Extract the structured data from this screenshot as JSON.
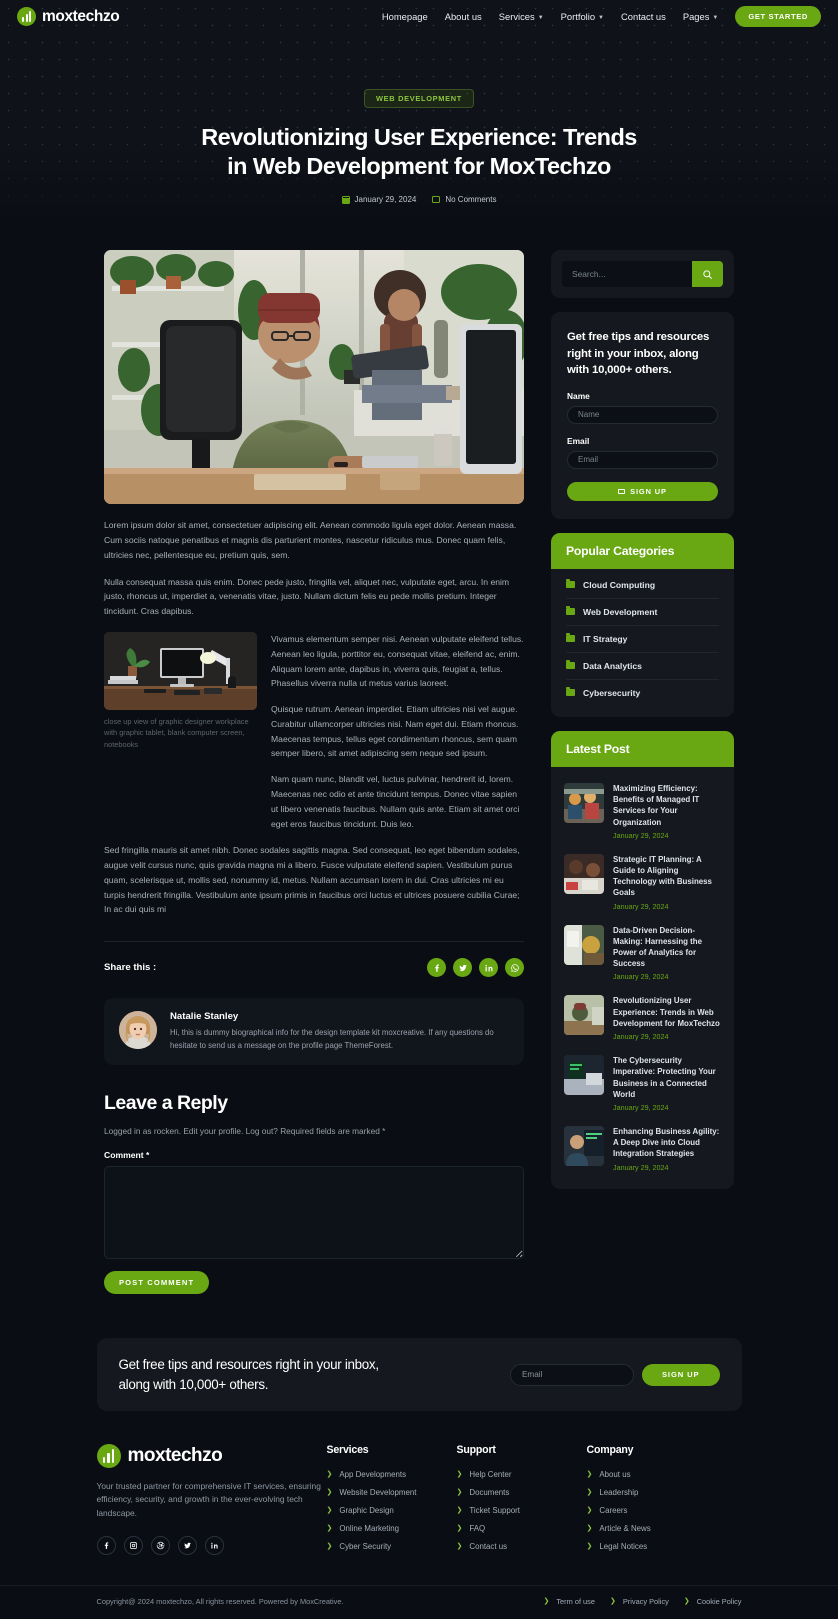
{
  "brand": {
    "name": "moxtechzo",
    "logo_icon": "bar-chart-circle-logo"
  },
  "nav": {
    "items": [
      {
        "label": "Homepage",
        "has_dropdown": false
      },
      {
        "label": "About us",
        "has_dropdown": false
      },
      {
        "label": "Services",
        "has_dropdown": true
      },
      {
        "label": "Portfolio",
        "has_dropdown": true
      },
      {
        "label": "Contact us",
        "has_dropdown": false
      },
      {
        "label": "Pages",
        "has_dropdown": true
      }
    ],
    "cta_label": "GET STARTED"
  },
  "hero": {
    "tag": "WEB DEVELOPMENT",
    "title_line1": "Revolutionizing User Experience: Trends",
    "title_line2": "in Web Development for MoxTechzo",
    "date": "January 29, 2024",
    "comments": "No Comments"
  },
  "article": {
    "p1": "Lorem ipsum dolor sit amet, consectetuer adipiscing elit. Aenean commodo ligula eget dolor. Aenean massa. Cum sociis natoque penatibus et magnis dis parturient montes, nascetur ridiculus mus. Donec quam felis, ultricies nec, pellentesque eu, pretium quis, sem.",
    "p2": "Nulla consequat massa quis enim. Donec pede justo, fringilla vel, aliquet nec, vulputate eget, arcu. In enim justo, rhoncus ut, imperdiet a, venenatis vitae, justo. Nullam dictum felis eu pede mollis pretium. Integer tincidunt. Cras dapibus.",
    "image_caption": "close up view of graphic designer workplace with graphic tablet, blank computer screen, notebooks",
    "p3": "Vivamus elementum semper nisi. Aenean vulputate eleifend tellus. Aenean leo ligula, porttitor eu, consequat vitae, eleifend ac, enim. Aliquam lorem ante, dapibus in, viverra quis, feugiat a, tellus. Phasellus viverra nulla ut metus varius laoreet.",
    "p4": "Quisque rutrum. Aenean imperdiet. Etiam ultricies nisi vel augue. Curabitur ullamcorper ultricies nisi. Nam eget dui. Etiam rhoncus. Maecenas tempus, tellus eget condimentum rhoncus, sem quam semper libero, sit amet adipiscing sem neque sed ipsum.",
    "p5": "Nam quam nunc, blandit vel, luctus pulvinar, hendrerit id, lorem. Maecenas nec odio et ante tincidunt tempus. Donec vitae sapien ut libero venenatis faucibus. Nullam quis ante. Etiam sit amet orci eget eros faucibus tincidunt. Duis leo.",
    "p6": "Sed fringilla mauris sit amet nibh. Donec sodales sagittis magna. Sed consequat, leo eget bibendum sodales, augue velit cursus nunc, quis gravida magna mi a libero. Fusce vulputate eleifend sapien. Vestibulum purus quam, scelerisque ut, mollis sed, nonummy id, metus. Nullam accumsan lorem in dui. Cras ultricies mi eu turpis hendrerit fringilla. Vestibulum ante ipsum primis in faucibus orci luctus et ultrices posuere cubilia Curae; In ac dui quis mi"
  },
  "share": {
    "label": "Share this :",
    "icons": [
      "facebook-icon",
      "twitter-icon",
      "linkedin-icon",
      "whatsapp-icon"
    ]
  },
  "author": {
    "name": "Natalie Stanley",
    "bio": "Hi, this is dummy biographical info for the design template kit moxcreative. If any questions do hesitate to send us a message on the profile page ThemeForest."
  },
  "reply": {
    "title": "Leave a Reply",
    "logged_text": "Logged in as rocken. Edit your profile. Log out? Required fields are marked *",
    "comment_label": "Comment *",
    "comment_value": "",
    "submit_label": "POST COMMENT"
  },
  "sidebar": {
    "search": {
      "placeholder": "Search...",
      "value": "",
      "icon": "search-icon"
    },
    "newsletter": {
      "heading": "Get free tips and resources right in your inbox, along with 10,000+ others.",
      "name_label": "Name",
      "name_placeholder": "Name",
      "name_value": "",
      "email_label": "Email",
      "email_placeholder": "Email",
      "email_value": "",
      "button_label": "SIGN UP"
    },
    "categories": {
      "heading": "Popular Categories",
      "items": [
        {
          "label": "Cloud Computing"
        },
        {
          "label": "Web Development"
        },
        {
          "label": "IT Strategy"
        },
        {
          "label": "Data Analytics"
        },
        {
          "label": "Cybersecurity"
        }
      ]
    },
    "latest": {
      "heading": "Latest Post",
      "items": [
        {
          "title": "Maximizing Efficiency: Benefits of Managed IT Services for Your Organization",
          "date": "January 29, 2024"
        },
        {
          "title": "Strategic IT Planning: A Guide to Aligning Technology with Business Goals",
          "date": "January 29, 2024"
        },
        {
          "title": "Data-Driven Decision-Making: Harnessing the Power of Analytics for Success",
          "date": "January 29, 2024"
        },
        {
          "title": "Revolutionizing User Experience: Trends in Web Development for MoxTechzo",
          "date": "January 29, 2024"
        },
        {
          "title": "The Cybersecurity Imperative: Protecting Your Business in a Connected World",
          "date": "January 29, 2024"
        },
        {
          "title": "Enhancing Business Agility: A Deep Dive into Cloud Integration Strategies",
          "date": "January 29, 2024"
        }
      ]
    }
  },
  "cta": {
    "line1": "Get free tips and resources right in your inbox,",
    "line2": "along with 10,000+ others.",
    "email_placeholder": "Email",
    "email_value": "",
    "button_label": "SIGN UP"
  },
  "footer": {
    "brand_name": "moxtechzo",
    "description": "Your trusted partner for comprehensive IT services, ensuring efficiency, security, and growth in the ever-evolving tech landscape.",
    "socials": [
      "facebook-icon",
      "instagram-icon",
      "dribbble-icon",
      "twitter-icon",
      "linkedin-icon"
    ],
    "columns": [
      {
        "heading": "Services",
        "links": [
          "App Developments",
          "Website Development",
          "Graphic Design",
          "Online Marketing",
          "Cyber Security"
        ]
      },
      {
        "heading": "Support",
        "links": [
          "Help Center",
          "Documents",
          "Ticket Support",
          "FAQ",
          "Contact us"
        ]
      },
      {
        "heading": "Company",
        "links": [
          "About us",
          "Leadership",
          "Careers",
          "Article & News",
          "Legal Notices"
        ]
      }
    ],
    "copyright": "Copyright@ 2024 moxtechzo, All rights reserved. Powered by MoxCreative.",
    "legal_links": [
      "Term of use",
      "Privacy Policy",
      "Cookie Policy"
    ]
  },
  "colors": {
    "accent": "#69a713",
    "accent_text": "#8dc63f",
    "bg": "#0a0d14",
    "card": "#15181e"
  }
}
